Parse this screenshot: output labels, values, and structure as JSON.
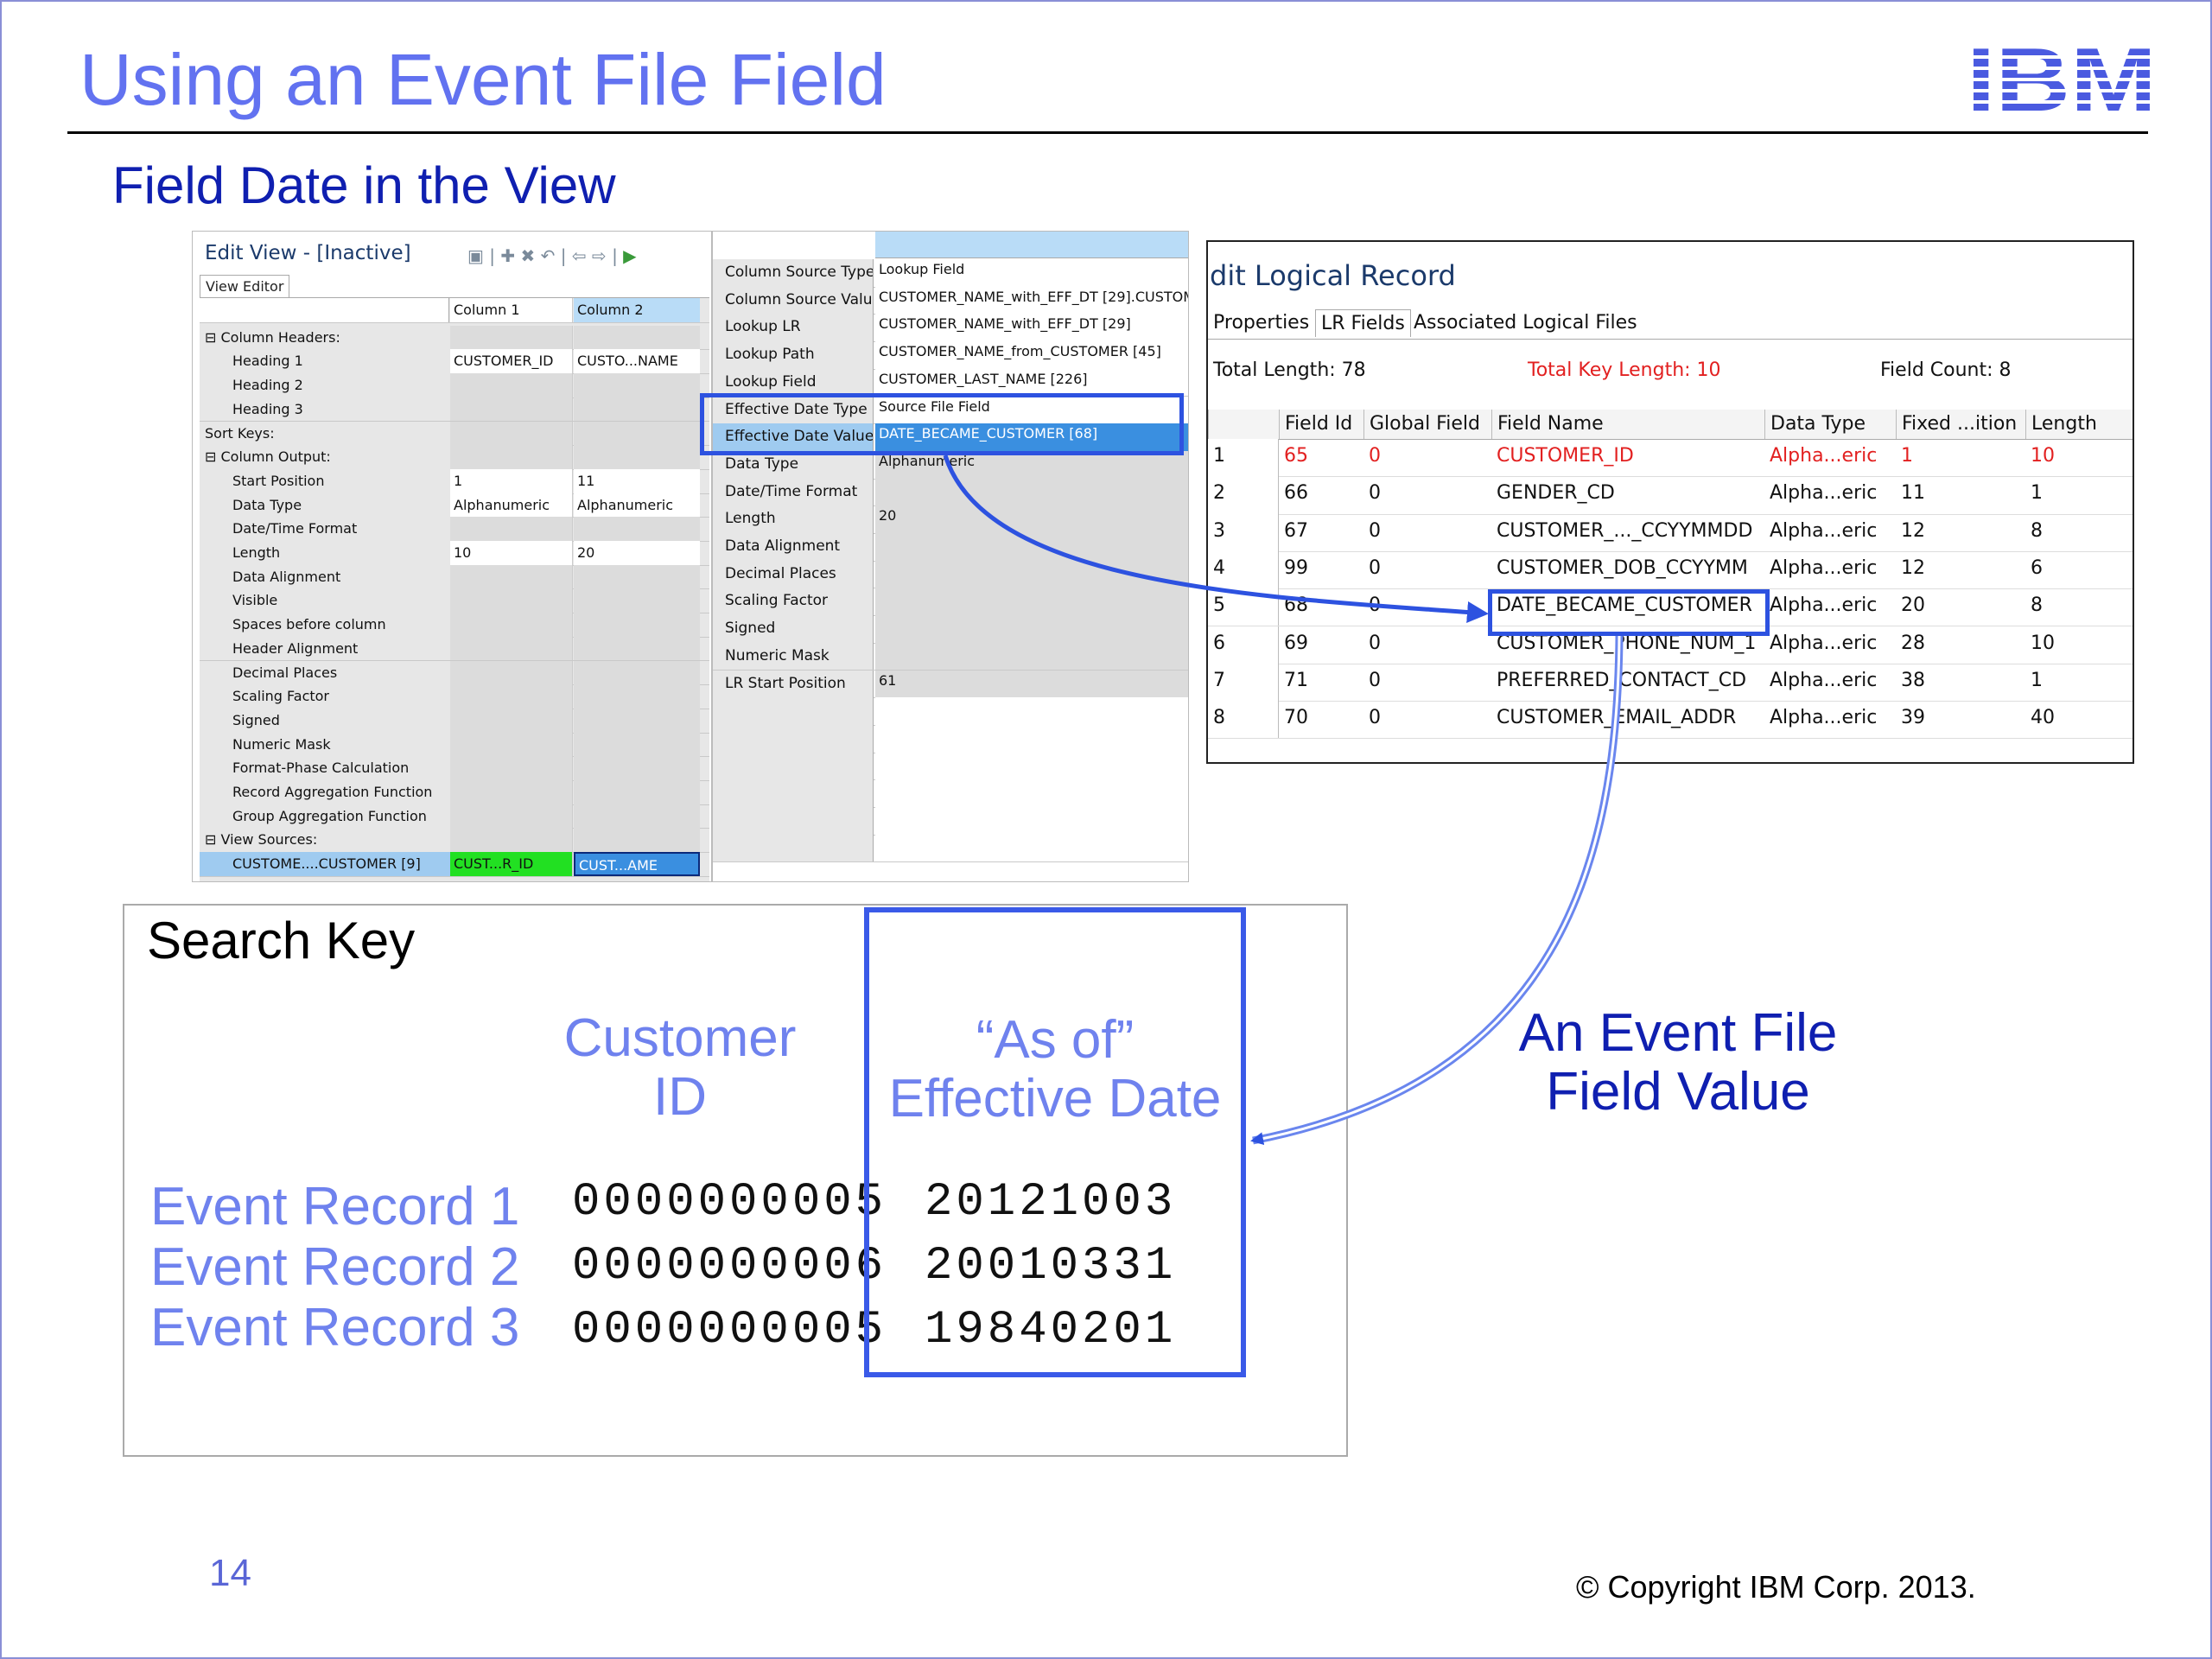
{
  "slide": {
    "title": "Using an Event File Field",
    "subtitle": "Field Date in the View",
    "page_number": "14",
    "copyright": "© Copyright IBM Corp. 2013.",
    "logo_text": "IBM"
  },
  "edit_view": {
    "title": "Edit View - [Inactive]",
    "tab": "View Editor",
    "column1": "Column 1",
    "column2": "Column 2",
    "rows": [
      {
        "label": "⊟ Column Headers:",
        "c1": "",
        "c2": ""
      },
      {
        "label": "Heading 1",
        "c1": "CUSTOMER_ID",
        "c2": "CUSTO...NAME"
      },
      {
        "label": "Heading 2",
        "c1": "",
        "c2": ""
      },
      {
        "label": "Heading 3",
        "c1": "",
        "c2": ""
      },
      {
        "label": "Sort Keys:",
        "c1": "",
        "c2": ""
      },
      {
        "label": "⊟ Column Output:",
        "c1": "",
        "c2": ""
      },
      {
        "label": "Start Position",
        "c1": "1",
        "c2": "11"
      },
      {
        "label": "Data Type",
        "c1": "Alphanumeric",
        "c2": "Alphanumeric"
      },
      {
        "label": "Date/Time Format",
        "c1": "",
        "c2": ""
      },
      {
        "label": "Length",
        "c1": "10",
        "c2": "20"
      },
      {
        "label": "Data Alignment",
        "c1": "",
        "c2": ""
      },
      {
        "label": "Visible",
        "c1": "",
        "c2": ""
      },
      {
        "label": "Spaces before column",
        "c1": "",
        "c2": ""
      },
      {
        "label": "Header Alignment",
        "c1": "",
        "c2": ""
      },
      {
        "label": "Decimal Places",
        "c1": "",
        "c2": ""
      },
      {
        "label": "Scaling Factor",
        "c1": "",
        "c2": ""
      },
      {
        "label": "Signed",
        "c1": "",
        "c2": ""
      },
      {
        "label": "Numeric Mask",
        "c1": "",
        "c2": ""
      },
      {
        "label": "Format-Phase Calculation",
        "c1": "",
        "c2": ""
      },
      {
        "label": "Record Aggregation Function",
        "c1": "",
        "c2": ""
      },
      {
        "label": "Group Aggregation Function",
        "c1": "",
        "c2": ""
      },
      {
        "label": "⊟ View Sources:",
        "c1": "",
        "c2": ""
      },
      {
        "label": "CUSTOME....CUSTOMER [9]",
        "c1": "CUST...R_ID",
        "c2": "CUST...AME"
      }
    ]
  },
  "properties": {
    "rows": [
      {
        "label": "Column Source Type",
        "value": "Lookup Field"
      },
      {
        "label": "Column Source Value",
        "value": "CUSTOMER_NAME_with_EFF_DT [29].CUSTOM"
      },
      {
        "label": "Lookup LR",
        "value": "CUSTOMER_NAME_with_EFF_DT [29]"
      },
      {
        "label": "Lookup Path",
        "value": "CUSTOMER_NAME_from_CUSTOMER [45]"
      },
      {
        "label": "Lookup Field",
        "value": "CUSTOMER_LAST_NAME [226]"
      },
      {
        "label": "Effective Date Type",
        "value": "Source File Field"
      },
      {
        "label": "Effective Date Value",
        "value": "DATE_BECAME_CUSTOMER [68]"
      },
      {
        "label": "Data Type",
        "value": "Alphanumeric"
      },
      {
        "label": "Date/Time Format",
        "value": ""
      },
      {
        "label": "Length",
        "value": "20"
      },
      {
        "label": "Data Alignment",
        "value": ""
      },
      {
        "label": "Decimal Places",
        "value": ""
      },
      {
        "label": "Scaling Factor",
        "value": ""
      },
      {
        "label": "Signed",
        "value": ""
      },
      {
        "label": "Numeric Mask",
        "value": ""
      },
      {
        "label": "LR Start Position",
        "value": "61"
      }
    ]
  },
  "logical_record": {
    "title": "dit Logical Record",
    "tabs": [
      "Properties",
      "LR Fields",
      "Associated Logical Files"
    ],
    "total_length": "Total Length: 78",
    "total_key_length": "Total Key Length: 10",
    "field_count": "Field Count: 8",
    "headers": [
      "",
      "Field Id",
      "Global Field",
      "Field Name",
      "Data Type",
      "Fixed ...ition",
      "Length"
    ],
    "rows": [
      [
        "1",
        "65",
        "0",
        "CUSTOMER_ID",
        "Alpha...eric",
        "1",
        "10"
      ],
      [
        "2",
        "66",
        "0",
        "GENDER_CD",
        "Alpha...eric",
        "11",
        "1"
      ],
      [
        "3",
        "67",
        "0",
        "CUSTOMER_..._CCYYMMDD",
        "Alpha...eric",
        "12",
        "8"
      ],
      [
        "4",
        "99",
        "0",
        "CUSTOMER_DOB_CCYYMM",
        "Alpha...eric",
        "12",
        "6"
      ],
      [
        "5",
        "68",
        "0",
        "DATE_BECAME_CUSTOMER",
        "Alpha...eric",
        "20",
        "8"
      ],
      [
        "6",
        "69",
        "0",
        "CUSTOMER_PHONE_NUM_1",
        "Alpha...eric",
        "28",
        "10"
      ],
      [
        "7",
        "71",
        "0",
        "PREFERRED_CONTACT_CD",
        "Alpha...eric",
        "38",
        "1"
      ],
      [
        "8",
        "70",
        "0",
        "CUSTOMER_EMAIL_ADDR",
        "Alpha...eric",
        "39",
        "40"
      ]
    ]
  },
  "search_key": {
    "title": "Search Key",
    "col_customer_1": "Customer",
    "col_customer_2": "ID",
    "col_date_1": "“As of”",
    "col_date_2": "Effective Date",
    "records": [
      {
        "label": "Event Record 1",
        "id": "0000000005",
        "date": "20121003"
      },
      {
        "label": "Event Record 2",
        "id": "0000000006",
        "date": "20010331"
      },
      {
        "label": "Event Record 3",
        "id": "0000000005",
        "date": "19840201"
      }
    ]
  },
  "callout": {
    "line1": "An Event File",
    "line2": "Field Value"
  },
  "colors": {
    "title": "#6272f0",
    "subtitle": "#0f1fb0",
    "highlight": "#2d52e0",
    "red": "#e22020"
  }
}
